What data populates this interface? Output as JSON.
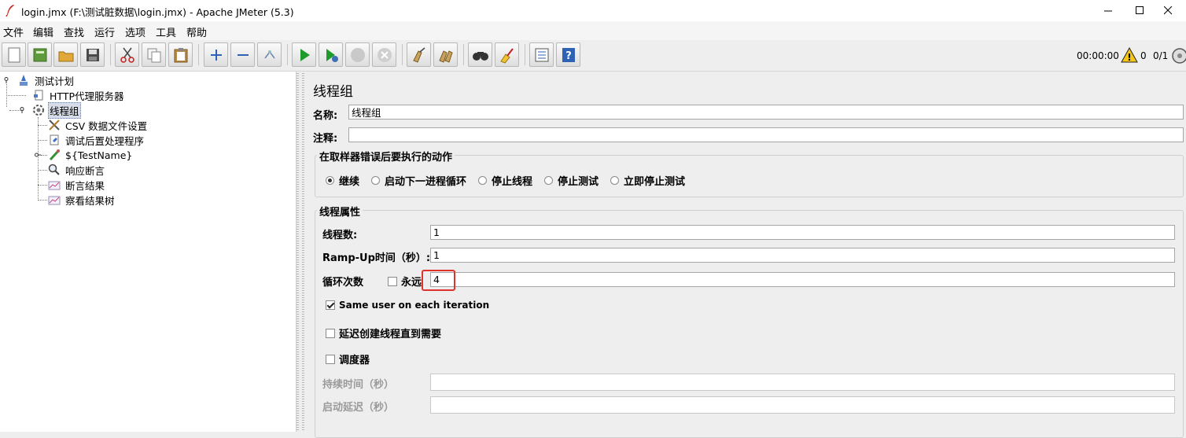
{
  "window": {
    "title": "login.jmx (F:\\测试脏数据\\login.jmx) - Apache JMeter (5.3)",
    "controls": [
      "minimize-icon",
      "maximize-icon",
      "close-icon"
    ]
  },
  "menu": {
    "items": [
      "文件",
      "编辑",
      "查找",
      "运行",
      "选项",
      "工具",
      "帮助"
    ]
  },
  "toolbar": {
    "buttons": [
      "new-icon",
      "templates-icon",
      "open-icon",
      "save-icon",
      "cut-icon",
      "copy-icon",
      "paste-icon",
      "expand-icon",
      "collapse-icon",
      "toggle-icon",
      "start-icon",
      "start-no-timers-icon",
      "stop-icon",
      "shutdown-icon",
      "clear-icon",
      "clear-all-icon",
      "search-icon",
      "reset-search-icon",
      "function-helper-icon",
      "help-icon"
    ],
    "timer": "00:00:00",
    "warning_count": "0",
    "threads": "0/1"
  },
  "tree": {
    "nodes": [
      {
        "label": "测试计划",
        "icon": "test-plan-icon"
      },
      {
        "label": "HTTP代理服务器",
        "icon": "proxy-server-icon"
      },
      {
        "label": "线程组",
        "icon": "thread-group-icon"
      },
      {
        "label": "CSV 数据文件设置",
        "icon": "csv-config-icon"
      },
      {
        "label": "调试后置处理程序",
        "icon": "debug-postprocessor-icon"
      },
      {
        "label": "${TestName}",
        "icon": "sampler-icon"
      },
      {
        "label": "响应断言",
        "icon": "assertion-icon"
      },
      {
        "label": "断言结果",
        "icon": "listener-icon"
      },
      {
        "label": "察看结果树",
        "icon": "listener-icon"
      }
    ]
  },
  "panel": {
    "title": "线程组",
    "name_label": "名称:",
    "name_value": "线程组",
    "comment_label": "注释:",
    "comment_value": "",
    "error_action": {
      "title": "在取样器错误后要执行的动作",
      "options": [
        "继续",
        "启动下一进程循环",
        "停止线程",
        "停止测试",
        "立即停止测试"
      ],
      "selected": "继续"
    },
    "thread_props": {
      "title": "线程属性",
      "threads_label": "线程数:",
      "threads_value": "1",
      "rampup_label": "Ramp-Up时间（秒）:",
      "rampup_value": "1",
      "loop_label": "循环次数",
      "forever_label": "永远",
      "forever_checked": false,
      "loop_value": "4",
      "same_user_label": "Same user on each iteration",
      "same_user_checked": true,
      "delay_label": "延迟创建线程直到需要",
      "delay_checked": false,
      "scheduler_label": "调度器",
      "scheduler_checked": false,
      "duration_label": "持续时间（秒）",
      "duration_value": "",
      "startup_delay_label": "启动延迟（秒）",
      "startup_delay_value": ""
    }
  }
}
